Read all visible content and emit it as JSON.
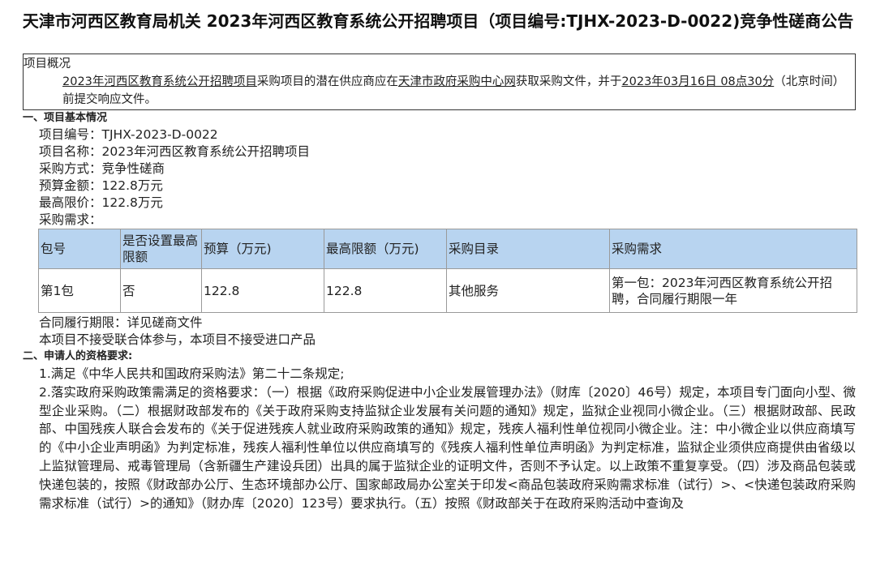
{
  "title": "天津市河西区教育局机关 2023年河西区教育系统公开招聘项目（项目编号:TJHX-2023-D-0022)竞争性磋商公告",
  "overview": {
    "label": "项目概况",
    "project": "2023年河西区教育系统公开招聘项目",
    "text1": "采购项目的潜在供应商应在",
    "site": "天津市政府采购中心网",
    "text2": "获取采购文件，并于",
    "deadline": "2023年03月16日 08点30分",
    "text3": "（北京时间）前提交响应文件。"
  },
  "section1": {
    "title": "一、项目基本情况",
    "fields": [
      "项目编号：TJHX-2023-D-0022",
      "项目名称：2023年河西区教育系统公开招聘项目",
      "采购方式：竞争性磋商",
      "预算金额：122.8万元",
      "最高限价：122.8万元",
      "采购需求："
    ],
    "table": {
      "headers": [
        "包号",
        "是否设置最高限额",
        "预算（万元)",
        "最高限额（万元)",
        "采购目录",
        "采购需求"
      ],
      "rows": [
        [
          "第1包",
          "否",
          "122.8",
          "122.8",
          "其他服务",
          "第一包：2023年河西区教育系统公开招聘，合同履行期限一年"
        ]
      ]
    },
    "after": [
      "合同履行期限：详见磋商文件",
      "本项目不接受联合体参与，本项目不接受进口产品"
    ]
  },
  "section2": {
    "title": "二、申请人的资格要求:",
    "items": [
      "1.满足《中华人民共和国政府采购法》第二十二条规定;",
      "2.落实政府采购政策需满足的资格要求：（一）根据《政府采购促进中小企业发展管理办法》（财库〔2020〕46号）规定，本项目专门面向小型、微型企业采购。（二）根据财政部发布的《关于政府采购支持监狱企业发展有关问题的通知》规定，监狱企业视同小微企业。（三）根据财政部、民政部、中国残疾人联合会发布的《关于促进残疾人就业政府采购政策的通知》规定，残疾人福利性单位视同小微企业。注：中小微企业以供应商填写的《中小企业声明函》为判定标准，残疾人福利性单位以供应商填写的《残疾人福利性单位声明函》为判定标准，监狱企业须供应商提供由省级以上监狱管理局、戒毒管理局（含新疆生产建设兵团）出具的属于监狱企业的证明文件，否则不予认定。以上政策不重复享受。（四）涉及商品包装或快递包装的，按照《财政部办公厅、生态环境部办公厅、国家邮政局办公室关于印发<商品包装政府采购需求标准（试行）>、<快递包装政府采购需求标准（试行）>的通知》（财办库〔2020〕123号）要求执行。（五）按照《财政部关于在政府采购活动中查询及"
    ]
  }
}
